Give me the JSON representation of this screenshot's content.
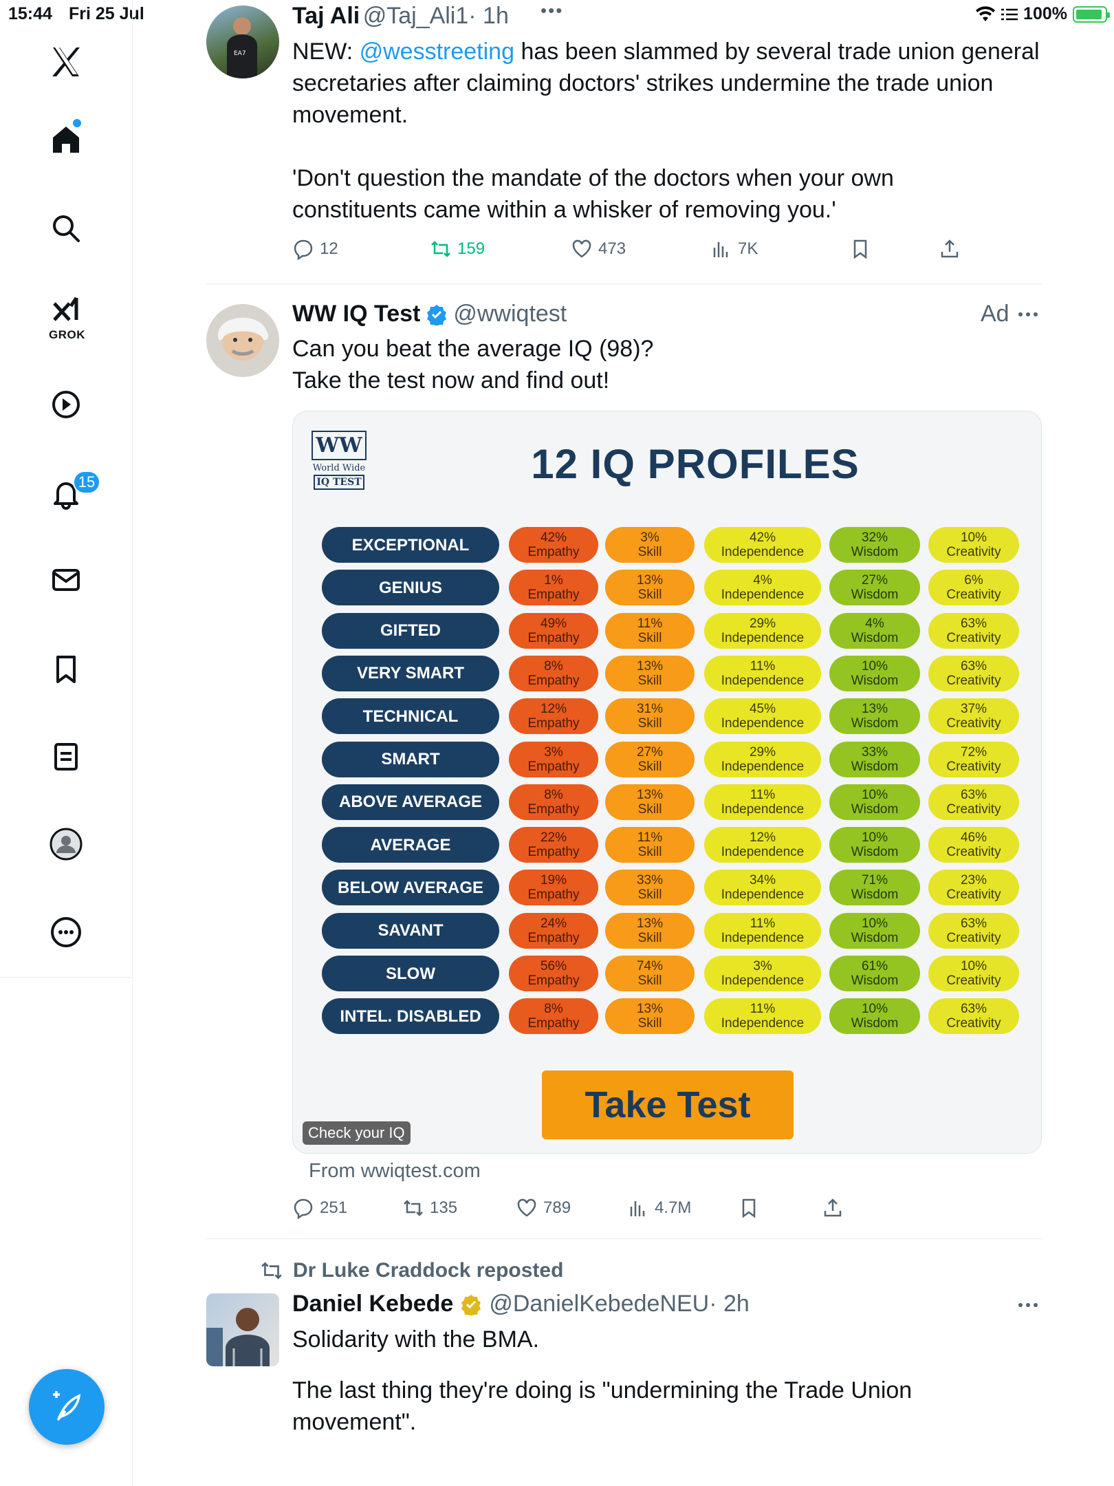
{
  "status": {
    "time": "15:44",
    "date": "Fri 25 Jul",
    "battery": "100%"
  },
  "sidebar": {
    "grok_label": "GROK",
    "notifications_count": "15"
  },
  "tweet1": {
    "name": "Taj Ali",
    "handle": "@Taj_Ali1",
    "time": "· 1h",
    "more": "•••",
    "text_prefix": "NEW: ",
    "mention": "@wesstreeting",
    "text_rest1": " has been slammed by several trade union general",
    "text_line2": "secretaries after claiming doctors' strikes undermine the trade union",
    "text_line3": "movement.",
    "quote_line1": "'Don't question the mandate of the doctors when your own",
    "quote_line2": "constituents came within a whisker of removing you.'",
    "replies": "12",
    "reposts": "159",
    "likes": "473",
    "views": "7K"
  },
  "tweet2": {
    "name": "WW IQ Test",
    "handle": "@wwiqtest",
    "ad": "Ad",
    "line1": "Can you beat the average IQ (98)?",
    "line2": "Take the test now and find out!",
    "card_from": "From wwiqtest.com",
    "replies": "251",
    "reposts": "135",
    "likes": "789",
    "views": "4.7M",
    "card": {
      "logo_top": "WW",
      "logo_mid": "World Wide",
      "logo_bottom": "IQ TEST",
      "title": "12 IQ PROFILES",
      "button": "Take Test",
      "badge": "Check your IQ",
      "attr_labels": {
        "emp": "Empathy",
        "skill": "Skill",
        "ind": "Independence",
        "wis": "Wisdom",
        "cre": "Creativity"
      },
      "rows": [
        {
          "label": "EXCEPTIONAL",
          "emp": "42%",
          "skill": "3%",
          "ind": "42%",
          "wis": "32%",
          "cre": "10%"
        },
        {
          "label": "GENIUS",
          "emp": "1%",
          "skill": "13%",
          "ind": "4%",
          "wis": "27%",
          "cre": "6%"
        },
        {
          "label": "GIFTED",
          "emp": "49%",
          "skill": "11%",
          "ind": "29%",
          "wis": "4%",
          "cre": "63%"
        },
        {
          "label": "VERY SMART",
          "emp": "8%",
          "skill": "13%",
          "ind": "11%",
          "wis": "10%",
          "cre": "63%"
        },
        {
          "label": "TECHNICAL",
          "emp": "12%",
          "skill": "31%",
          "ind": "45%",
          "wis": "13%",
          "cre": "37%"
        },
        {
          "label": "SMART",
          "emp": "3%",
          "skill": "27%",
          "ind": "29%",
          "wis": "33%",
          "cre": "72%"
        },
        {
          "label": "ABOVE AVERAGE",
          "emp": "8%",
          "skill": "13%",
          "ind": "11%",
          "wis": "10%",
          "cre": "63%"
        },
        {
          "label": "AVERAGE",
          "emp": "22%",
          "skill": "11%",
          "ind": "12%",
          "wis": "10%",
          "cre": "46%"
        },
        {
          "label": "BELOW AVERAGE",
          "emp": "19%",
          "skill": "33%",
          "ind": "34%",
          "wis": "71%",
          "cre": "23%"
        },
        {
          "label": "SAVANT",
          "emp": "24%",
          "skill": "13%",
          "ind": "11%",
          "wis": "10%",
          "cre": "63%"
        },
        {
          "label": "SLOW",
          "emp": "56%",
          "skill": "74%",
          "ind": "3%",
          "wis": "61%",
          "cre": "10%"
        },
        {
          "label": "INTEL. DISABLED",
          "emp": "8%",
          "skill": "13%",
          "ind": "11%",
          "wis": "10%",
          "cre": "63%"
        }
      ]
    }
  },
  "tweet3": {
    "repost_label": "Dr Luke Craddock reposted",
    "name": "Daniel Kebede",
    "handle": "@DanielKebedeNEU",
    "time": "· 2h",
    "line1": "Solidarity with the BMA.",
    "line2": "The last thing they're doing is \"undermining the Trade Union",
    "line3": "movement\"."
  },
  "colors": {
    "accent": "#1d9bf0",
    "repost_green": "#00ba7c",
    "brand_navy": "#1b3f63"
  }
}
